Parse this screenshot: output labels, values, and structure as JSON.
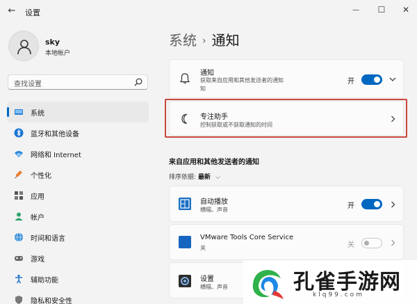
{
  "window": {
    "title": "设置",
    "back_glyph": "←",
    "minimize_glyph": "—",
    "maximize_glyph": "☐",
    "close_glyph": "✕"
  },
  "profile": {
    "name": "sky",
    "account_type": "本地帐户"
  },
  "search": {
    "placeholder": "查找设置"
  },
  "sidebar": {
    "items": [
      {
        "label": "系统",
        "icon": "system-icon",
        "active": true
      },
      {
        "label": "蓝牙和其他设备",
        "icon": "bluetooth-icon"
      },
      {
        "label": "网络和 Internet",
        "icon": "wifi-icon"
      },
      {
        "label": "个性化",
        "icon": "personalization-icon"
      },
      {
        "label": "应用",
        "icon": "apps-icon"
      },
      {
        "label": "帐户",
        "icon": "account-icon"
      },
      {
        "label": "时间和语言",
        "icon": "globe-icon"
      },
      {
        "label": "游戏",
        "icon": "game-icon"
      },
      {
        "label": "辅助功能",
        "icon": "accessibility-icon"
      },
      {
        "label": "隐私和安全性",
        "icon": "shield-icon"
      }
    ]
  },
  "breadcrumb": {
    "parent": "系统",
    "separator": "›",
    "current": "通知"
  },
  "notifications_card": {
    "title": "通知",
    "subtitle_line1": "获取来自应用和其他发送者的通知",
    "subtitle_line2": "知",
    "toggle_label": "开",
    "toggle_on": true
  },
  "focus_assist_card": {
    "title": "专注助手",
    "subtitle": "控制获取或不获取通知的时间"
  },
  "section": {
    "title": "来自应用和其他发送者的通知",
    "sort_label": "排序依据:",
    "sort_value": "最新",
    "sort_chevron": "⌵"
  },
  "app_rows": [
    {
      "name": "自动播放",
      "detail": "横幅、声音",
      "toggle_label": "开",
      "toggle_on": true
    },
    {
      "name": "VMware Tools Core Service",
      "detail": "关",
      "toggle_label": "关",
      "toggle_on": false
    },
    {
      "name": "设置",
      "detail": "横幅、声音"
    }
  ],
  "watermark": {
    "text": "孔雀手游网",
    "url": "klq99.com"
  },
  "colors": {
    "accent": "#0067c0",
    "highlight": "#c9473d",
    "background": "#f3f3f3"
  }
}
